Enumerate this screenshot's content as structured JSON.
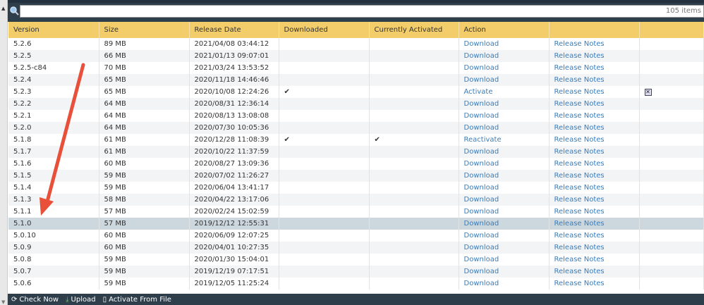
{
  "search": {
    "value": "",
    "count": "105 items"
  },
  "columns": [
    "Version",
    "Size",
    "Release Date",
    "Downloaded",
    "Currently Activated",
    "Action",
    "",
    ""
  ],
  "rows": [
    {
      "version": "5.2.6",
      "size": "89 MB",
      "date": "2021/04/08 03:44:12",
      "downloaded": "",
      "activated": "",
      "action": "Download",
      "notes": "Release Notes",
      "extra": ""
    },
    {
      "version": "5.2.5",
      "size": "66 MB",
      "date": "2021/01/13 09:07:01",
      "downloaded": "",
      "activated": "",
      "action": "Download",
      "notes": "Release Notes",
      "extra": ""
    },
    {
      "version": "5.2.5-c84",
      "size": "70 MB",
      "date": "2021/03/24 13:53:52",
      "downloaded": "",
      "activated": "",
      "action": "Download",
      "notes": "Release Notes",
      "extra": ""
    },
    {
      "version": "5.2.4",
      "size": "65 MB",
      "date": "2020/11/18 14:46:46",
      "downloaded": "",
      "activated": "",
      "action": "Download",
      "notes": "Release Notes",
      "extra": ""
    },
    {
      "version": "5.2.3",
      "size": "65 MB",
      "date": "2020/10/08 12:24:26",
      "downloaded": "✔",
      "activated": "",
      "action": "Activate",
      "notes": "Release Notes",
      "extra": "✕"
    },
    {
      "version": "5.2.2",
      "size": "64 MB",
      "date": "2020/08/31 12:36:14",
      "downloaded": "",
      "activated": "",
      "action": "Download",
      "notes": "Release Notes",
      "extra": ""
    },
    {
      "version": "5.2.1",
      "size": "64 MB",
      "date": "2020/08/13 13:08:08",
      "downloaded": "",
      "activated": "",
      "action": "Download",
      "notes": "Release Notes",
      "extra": ""
    },
    {
      "version": "5.2.0",
      "size": "64 MB",
      "date": "2020/07/30 10:05:36",
      "downloaded": "",
      "activated": "",
      "action": "Download",
      "notes": "Release Notes",
      "extra": ""
    },
    {
      "version": "5.1.8",
      "size": "61 MB",
      "date": "2020/12/28 11:08:39",
      "downloaded": "✔",
      "activated": "✔",
      "action": "Reactivate",
      "notes": "Release Notes",
      "extra": ""
    },
    {
      "version": "5.1.7",
      "size": "61 MB",
      "date": "2020/10/22 11:37:59",
      "downloaded": "",
      "activated": "",
      "action": "Download",
      "notes": "Release Notes",
      "extra": ""
    },
    {
      "version": "5.1.6",
      "size": "60 MB",
      "date": "2020/08/27 13:09:36",
      "downloaded": "",
      "activated": "",
      "action": "Download",
      "notes": "Release Notes",
      "extra": ""
    },
    {
      "version": "5.1.5",
      "size": "59 MB",
      "date": "2020/07/02 11:26:27",
      "downloaded": "",
      "activated": "",
      "action": "Download",
      "notes": "Release Notes",
      "extra": ""
    },
    {
      "version": "5.1.4",
      "size": "59 MB",
      "date": "2020/06/04 13:41:17",
      "downloaded": "",
      "activated": "",
      "action": "Download",
      "notes": "Release Notes",
      "extra": ""
    },
    {
      "version": "5.1.3",
      "size": "58 MB",
      "date": "2020/04/22 13:17:06",
      "downloaded": "",
      "activated": "",
      "action": "Download",
      "notes": "Release Notes",
      "extra": ""
    },
    {
      "version": "5.1.1",
      "size": "57 MB",
      "date": "2020/02/24 15:02:59",
      "downloaded": "",
      "activated": "",
      "action": "Download",
      "notes": "Release Notes",
      "extra": ""
    },
    {
      "version": "5.1.0",
      "size": "57 MB",
      "date": "2019/12/12 12:55:31",
      "downloaded": "",
      "activated": "",
      "action": "Download",
      "notes": "Release Notes",
      "extra": "",
      "selected": true
    },
    {
      "version": "5.0.10",
      "size": "60 MB",
      "date": "2020/06/09 12:07:25",
      "downloaded": "",
      "activated": "",
      "action": "Download",
      "notes": "Release Notes",
      "extra": ""
    },
    {
      "version": "5.0.9",
      "size": "60 MB",
      "date": "2020/04/01 10:27:35",
      "downloaded": "",
      "activated": "",
      "action": "Download",
      "notes": "Release Notes",
      "extra": ""
    },
    {
      "version": "5.0.8",
      "size": "59 MB",
      "date": "2020/01/30 15:04:01",
      "downloaded": "",
      "activated": "",
      "action": "Download",
      "notes": "Release Notes",
      "extra": ""
    },
    {
      "version": "5.0.7",
      "size": "59 MB",
      "date": "2019/12/19 07:17:51",
      "downloaded": "",
      "activated": "",
      "action": "Download",
      "notes": "Release Notes",
      "extra": ""
    },
    {
      "version": "5.0.6",
      "size": "59 MB",
      "date": "2019/12/05 11:25:24",
      "downloaded": "",
      "activated": "",
      "action": "Download",
      "notes": "Release Notes",
      "extra": ""
    }
  ],
  "toolbar": {
    "check_now": "Check Now",
    "upload": "Upload",
    "activate_from_file": "Activate From File"
  },
  "colors": {
    "header": "#f2cd6a",
    "bar": "#2f3e4b",
    "link": "#3a7cb8",
    "selected": "#cdd7de",
    "arrow": "#e8503a"
  }
}
